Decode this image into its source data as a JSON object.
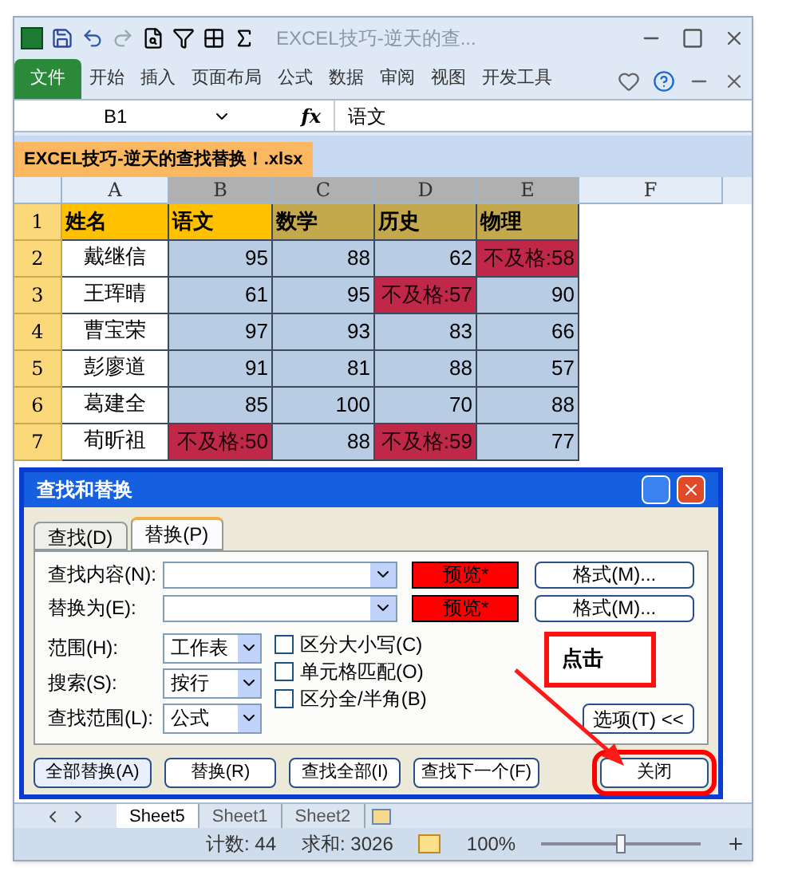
{
  "window": {
    "title": "EXCEL技巧-逆天的查..."
  },
  "ribbon_tabs": [
    {
      "label": "文件",
      "kind": "file",
      "selected": false
    },
    {
      "label": "开始",
      "kind": "tab",
      "selected": false
    },
    {
      "label": "插入",
      "kind": "tab",
      "selected": false
    },
    {
      "label": "页面布局",
      "kind": "tab",
      "selected": false
    },
    {
      "label": "公式",
      "kind": "tab",
      "selected": false
    },
    {
      "label": "数据",
      "kind": "tab",
      "selected": false
    },
    {
      "label": "审阅",
      "kind": "tab",
      "selected": false
    },
    {
      "label": "视图",
      "kind": "tab",
      "selected": false
    },
    {
      "label": "开发工具",
      "kind": "tab",
      "selected": false
    }
  ],
  "formula_bar": {
    "name_box": "B1",
    "fx": "fx",
    "value": "语文"
  },
  "workbook_tab": {
    "title": "EXCEL技巧-逆天的查找替换！.xlsx"
  },
  "grid": {
    "columns": [
      "A",
      "B",
      "C",
      "D",
      "E",
      "F"
    ],
    "rows": [
      {
        "header": "1",
        "cells": [
          {
            "text": "姓名",
            "kind": "head"
          },
          {
            "text": "语文",
            "kind": "head_active"
          },
          {
            "text": "数学",
            "kind": "head_dim"
          },
          {
            "text": "历史",
            "kind": "head_dim"
          },
          {
            "text": "物理",
            "kind": "head_dim"
          }
        ]
      },
      {
        "header": "2",
        "cells": [
          {
            "text": "戴继信",
            "kind": "name"
          },
          {
            "text": "95",
            "kind": "score"
          },
          {
            "text": "88",
            "kind": "score"
          },
          {
            "text": "62",
            "kind": "score"
          },
          {
            "text": "不及格:58",
            "kind": "fail"
          }
        ]
      },
      {
        "header": "3",
        "cells": [
          {
            "text": "王珲晴",
            "kind": "name"
          },
          {
            "text": "61",
            "kind": "score"
          },
          {
            "text": "95",
            "kind": "score"
          },
          {
            "text": "不及格:57",
            "kind": "fail"
          },
          {
            "text": "90",
            "kind": "score"
          }
        ]
      },
      {
        "header": "4",
        "cells": [
          {
            "text": "曹宝荣",
            "kind": "name"
          },
          {
            "text": "97",
            "kind": "score"
          },
          {
            "text": "93",
            "kind": "score"
          },
          {
            "text": "83",
            "kind": "score"
          },
          {
            "text": "66",
            "kind": "score"
          }
        ]
      },
      {
        "header": "5",
        "cells": [
          {
            "text": "彭廖道",
            "kind": "name"
          },
          {
            "text": "91",
            "kind": "score"
          },
          {
            "text": "81",
            "kind": "score"
          },
          {
            "text": "88",
            "kind": "score"
          },
          {
            "text": "57",
            "kind": "score"
          }
        ]
      },
      {
        "header": "6",
        "cells": [
          {
            "text": "葛建全",
            "kind": "name"
          },
          {
            "text": "85",
            "kind": "score"
          },
          {
            "text": "100",
            "kind": "score"
          },
          {
            "text": "70",
            "kind": "score"
          },
          {
            "text": "88",
            "kind": "score"
          }
        ]
      },
      {
        "header": "7",
        "cells": [
          {
            "text": "荀昕祖",
            "kind": "name"
          },
          {
            "text": "不及格:50",
            "kind": "fail"
          },
          {
            "text": "88",
            "kind": "score"
          },
          {
            "text": "不及格:59",
            "kind": "fail"
          },
          {
            "text": "77",
            "kind": "score"
          }
        ]
      }
    ]
  },
  "dialog": {
    "title": "查找和替换",
    "tabs": [
      {
        "label": "查找(D)",
        "selected": false
      },
      {
        "label": "替换(P)",
        "selected": true
      }
    ],
    "fields": [
      {
        "label": "查找内容(N):",
        "preview": "预览*",
        "format_button": "格式(M)..."
      },
      {
        "label": "替换为(E):",
        "preview": "预览*",
        "format_button": "格式(M)..."
      }
    ],
    "selects": [
      {
        "label": "范围(H):",
        "value": "工作表"
      },
      {
        "label": "搜索(S):",
        "value": "按行"
      },
      {
        "label": "查找范围(L):",
        "value": "公式"
      }
    ],
    "checkboxes": [
      {
        "label": "区分大小写(C)",
        "checked": false
      },
      {
        "label": "单元格匹配(O)",
        "checked": false
      },
      {
        "label": "区分全/半角(B)",
        "checked": false
      }
    ],
    "options_button": "选项(T) <<",
    "buttons": [
      {
        "label": "全部替换(A)",
        "highlighted": false
      },
      {
        "label": "替换(R)",
        "highlighted": false
      },
      {
        "label": "查找全部(I)",
        "highlighted": false
      },
      {
        "label": "查找下一个(F)",
        "highlighted": false
      },
      {
        "label": "关闭",
        "highlighted": true
      }
    ]
  },
  "callout": {
    "text": "点击"
  },
  "sheet_tabs": [
    {
      "label": "Sheet5",
      "selected": true
    },
    {
      "label": "Sheet1",
      "selected": false
    },
    {
      "label": "Sheet2",
      "selected": false
    }
  ],
  "status_bar": {
    "count": "计数: 44",
    "sum": "求和: 3026",
    "zoom": "100%",
    "zoom_slider": {
      "level": 0.5
    }
  }
}
